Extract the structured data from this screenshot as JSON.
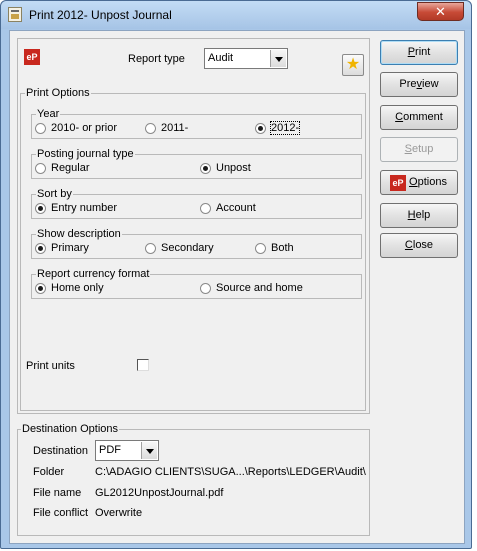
{
  "window": {
    "title": "Print 2012-  Unpost Journal",
    "close_glyph": "✕"
  },
  "header": {
    "logo_text": "eP",
    "report_type_label": "Report type",
    "report_type_value": "Audit",
    "favorite_icon": "★"
  },
  "print_options": {
    "title": "Print Options",
    "year": {
      "title": "Year",
      "options": [
        "2010- or prior",
        "2011-",
        "2012-"
      ],
      "selected": 2
    },
    "posting_journal_type": {
      "title": "Posting journal type",
      "options": [
        "Regular",
        "Unpost"
      ],
      "selected": 1
    },
    "sort_by": {
      "title": "Sort by",
      "options": [
        "Entry number",
        "Account"
      ],
      "selected": 0
    },
    "show_description": {
      "title": "Show description",
      "options": [
        "Primary",
        "Secondary",
        "Both"
      ],
      "selected": 0
    },
    "report_currency_format": {
      "title": "Report currency format",
      "options": [
        "Home only",
        "Source and home"
      ],
      "selected": 0
    },
    "print_units": {
      "label": "Print units",
      "checked": false
    }
  },
  "destination": {
    "title": "Destination Options",
    "destination_label": "Destination",
    "destination_value": "PDF",
    "folder_label": "Folder",
    "folder_value": "C:\\ADAGIO CLIENTS\\SUGA...\\Reports\\LEDGER\\Audit\\",
    "file_name_label": "File name",
    "file_name_value": "GL2012UnpostJournal.pdf",
    "file_conflict_label": "File conflict",
    "file_conflict_value": "Overwrite"
  },
  "buttons": {
    "print": {
      "pre": "",
      "key": "P",
      "post": "rint"
    },
    "preview": {
      "pre": "Pre",
      "key": "v",
      "post": "iew"
    },
    "comment": {
      "pre": "",
      "key": "C",
      "post": "omment"
    },
    "setup": {
      "pre": "",
      "key": "S",
      "post": "etup"
    },
    "options": {
      "logo": "eP",
      "pre": "",
      "key": "O",
      "post": "ptions"
    },
    "help": {
      "pre": "",
      "key": "H",
      "post": "elp"
    },
    "close": {
      "pre": "",
      "key": "C",
      "post": "lose"
    }
  }
}
